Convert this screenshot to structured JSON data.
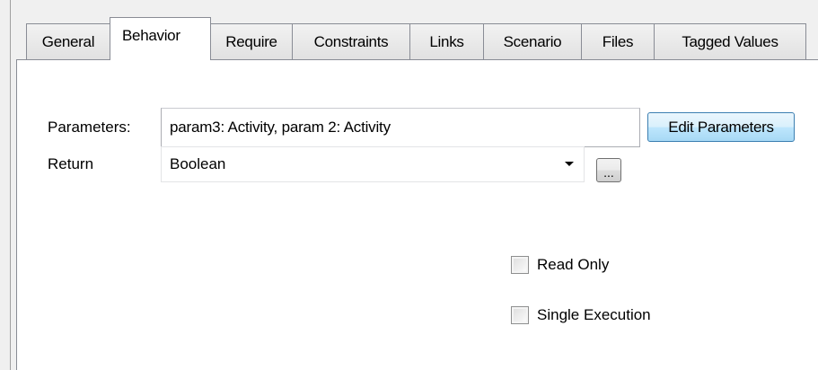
{
  "tabs": [
    {
      "label": "General"
    },
    {
      "label": "Behavior"
    },
    {
      "label": "Require"
    },
    {
      "label": "Constraints"
    },
    {
      "label": "Links"
    },
    {
      "label": "Scenario"
    },
    {
      "label": "Files"
    },
    {
      "label": "Tagged Values"
    }
  ],
  "active_tab": "Behavior",
  "behavior": {
    "parameters_label": "Parameters:",
    "parameters_value": "param3: Activity, param 2: Activity",
    "edit_parameters_label": "Edit Parameters",
    "return_label": "Return",
    "return_value": "Boolean",
    "browse_label": "...",
    "read_only_label": "Read Only",
    "read_only_checked": false,
    "single_execution_label": "Single Execution",
    "single_execution_checked": false
  }
}
